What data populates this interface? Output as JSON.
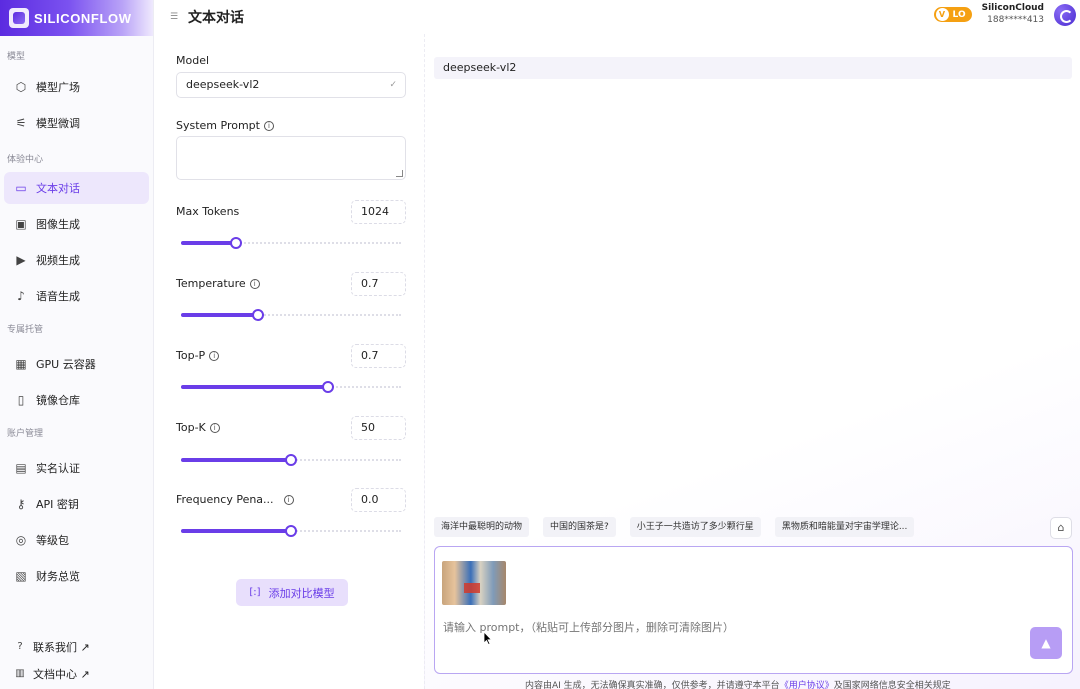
{
  "brand": {
    "logo_text": "SILICONFLOW",
    "accent": "#6a3de8"
  },
  "header": {
    "title": "文本对话",
    "level": "LO",
    "user_name": "SiliconCloud",
    "user_id": "188*****413"
  },
  "sidebar": {
    "sections": [
      {
        "title": "模型",
        "items": [
          {
            "label": "模型广场",
            "icon": "cube-icon"
          },
          {
            "label": "模型微调",
            "icon": "tune-icon"
          }
        ]
      },
      {
        "title": "体验中心",
        "items": [
          {
            "label": "文本对话",
            "icon": "chat-icon",
            "active": true
          },
          {
            "label": "图像生成",
            "icon": "image-icon"
          },
          {
            "label": "视频生成",
            "icon": "video-icon"
          },
          {
            "label": "语音生成",
            "icon": "mic-icon"
          }
        ]
      },
      {
        "title": "专属托管",
        "items": [
          {
            "label": "GPU 云容器",
            "icon": "chip-icon"
          },
          {
            "label": "镜像仓库",
            "icon": "repo-icon"
          }
        ]
      },
      {
        "title": "账户管理",
        "items": [
          {
            "label": "实名认证",
            "icon": "id-card-icon"
          },
          {
            "label": "API 密钥",
            "icon": "key-icon"
          },
          {
            "label": "等级包",
            "icon": "package-icon"
          },
          {
            "label": "财务总览",
            "icon": "finance-icon"
          }
        ]
      }
    ],
    "footer": [
      {
        "label": "联系我们 ↗"
      },
      {
        "label": "文档中心 ↗"
      }
    ]
  },
  "config": {
    "model_label": "Model",
    "model_value": "deepseek-vl2",
    "system_prompt_label": "System Prompt",
    "params": [
      {
        "label": "Max Tokens",
        "value": "1024",
        "fraction": 0.25
      },
      {
        "label": "Temperature",
        "value": "0.7",
        "fraction": 0.35
      },
      {
        "label": "Top-P",
        "value": "0.7",
        "fraction": 0.67
      },
      {
        "label": "Top-K",
        "value": "50",
        "fraction": 0.5
      },
      {
        "label": "Frequency Pena...",
        "value": "0.0",
        "fraction": 0.5
      }
    ],
    "compare_button": "添加对比模型"
  },
  "chat": {
    "model_tag": "deepseek-vl2",
    "suggestions": [
      "海洋中最聪明的动物",
      "中国的国茶是?",
      "小王子一共造访了多少颗行星",
      "黑物质和暗能量对宇宙学理论..."
    ],
    "input_placeholder": "请输入 prompt，（粘贴可上传部分图片，删除可清除图片）",
    "disclaimer_prefix": "内容由AI 生成，无法确保真实准确，仅供参考，并请遵守本平台",
    "disclaimer_link": "《用户协议》",
    "disclaimer_suffix": "及国家网络信息安全相关规定"
  }
}
